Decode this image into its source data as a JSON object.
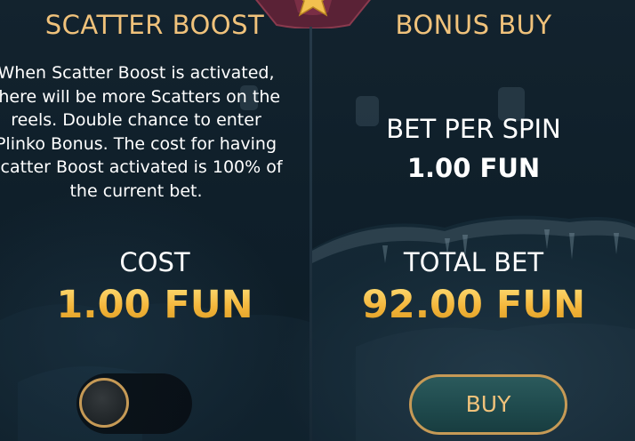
{
  "scatter_boost": {
    "title": "SCATTER BOOST",
    "description": "When Scatter Boost is activated, there will be more Scatters on the reels. Double chance to enter Plinko Bonus. The cost for having Scatter Boost activated is 100% of the current bet.",
    "cost_label": "COST",
    "cost_value": "1.00 FUN",
    "toggle_on": false
  },
  "bonus_buy": {
    "title": "BONUS BUY",
    "bet_label": "BET PER SPIN",
    "bet_value": "1.00 FUN",
    "total_label": "TOTAL BET",
    "total_value": "92.00 FUN",
    "buy_label": "BUY"
  },
  "colors": {
    "heading_gold": "#f0c27b",
    "value_gold": "#f6c148",
    "button_teal": "#1f4a4d",
    "border_gold": "#c69a56"
  }
}
